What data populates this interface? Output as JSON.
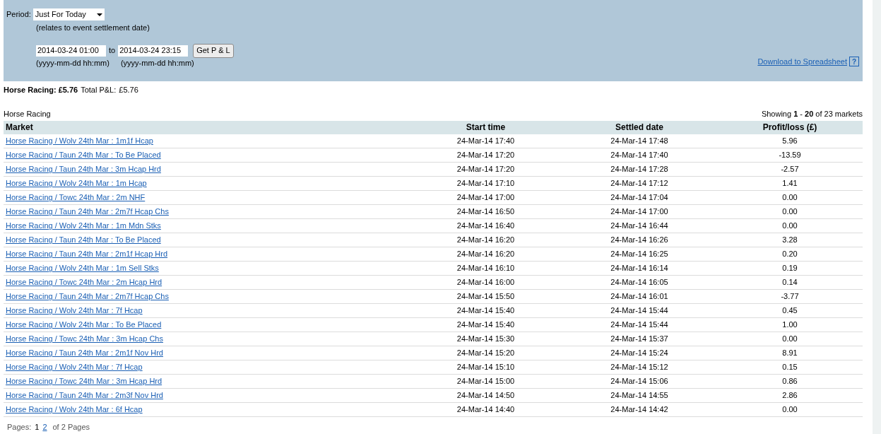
{
  "filter": {
    "period_label": "Period:",
    "period_value": "Just For Today",
    "period_note": "(relates to event settlement date)",
    "from": "2014-03-24 01:00",
    "to_label": "to",
    "to": "2014-03-24 23:15",
    "from_hint": "(yyyy-mm-dd hh:mm)",
    "to_hint": "(yyyy-mm-dd hh:mm)",
    "button": "Get P & L",
    "download_link": "Download to Spreadsheet",
    "help": "?"
  },
  "summary": {
    "sport_total": "Horse Racing: £5.76",
    "total_label": "Total P&L:",
    "total_value": "£5.76"
  },
  "table": {
    "title": "Horse Racing",
    "showing": "Showing **1** - **20** of 23 markets",
    "columns": [
      "Market",
      "Start time",
      "Settled date",
      "Profit/loss (£)"
    ],
    "rows": [
      [
        "Horse Racing / Wolv 24th Mar : 1m1f Hcap",
        "24-Mar-14 17:40",
        "24-Mar-14 17:48",
        "5.96"
      ],
      [
        "Horse Racing / Taun 24th Mar : To Be Placed",
        "24-Mar-14 17:20",
        "24-Mar-14 17:40",
        "-13.59"
      ],
      [
        "Horse Racing / Taun 24th Mar : 3m Hcap Hrd",
        "24-Mar-14 17:20",
        "24-Mar-14 17:28",
        "-2.57"
      ],
      [
        "Horse Racing / Wolv 24th Mar : 1m Hcap",
        "24-Mar-14 17:10",
        "24-Mar-14 17:12",
        "1.41"
      ],
      [
        "Horse Racing / Towc 24th Mar : 2m NHF",
        "24-Mar-14 17:00",
        "24-Mar-14 17:04",
        "0.00"
      ],
      [
        "Horse Racing / Taun 24th Mar : 2m7f Hcap Chs",
        "24-Mar-14 16:50",
        "24-Mar-14 17:00",
        "0.00"
      ],
      [
        "Horse Racing / Wolv 24th Mar : 1m Mdn Stks",
        "24-Mar-14 16:40",
        "24-Mar-14 16:44",
        "0.00"
      ],
      [
        "Horse Racing / Taun 24th Mar : To Be Placed",
        "24-Mar-14 16:20",
        "24-Mar-14 16:26",
        "3.28"
      ],
      [
        "Horse Racing / Taun 24th Mar : 2m1f Hcap Hrd",
        "24-Mar-14 16:20",
        "24-Mar-14 16:25",
        "0.20"
      ],
      [
        "Horse Racing / Wolv 24th Mar : 1m Sell Stks",
        "24-Mar-14 16:10",
        "24-Mar-14 16:14",
        "0.19"
      ],
      [
        "Horse Racing / Towc 24th Mar : 2m Hcap Hrd",
        "24-Mar-14 16:00",
        "24-Mar-14 16:05",
        "0.14"
      ],
      [
        "Horse Racing / Taun 24th Mar : 2m7f Hcap Chs",
        "24-Mar-14 15:50",
        "24-Mar-14 16:01",
        "-3.77"
      ],
      [
        "Horse Racing / Wolv 24th Mar : 7f Hcap",
        "24-Mar-14 15:40",
        "24-Mar-14 15:44",
        "0.45"
      ],
      [
        "Horse Racing / Wolv 24th Mar : To Be Placed",
        "24-Mar-14 15:40",
        "24-Mar-14 15:44",
        "1.00"
      ],
      [
        "Horse Racing / Towc 24th Mar : 3m Hcap Chs",
        "24-Mar-14 15:30",
        "24-Mar-14 15:37",
        "0.00"
      ],
      [
        "Horse Racing / Taun 24th Mar : 2m1f Nov Hrd",
        "24-Mar-14 15:20",
        "24-Mar-14 15:24",
        "8.91"
      ],
      [
        "Horse Racing / Wolv 24th Mar : 7f Hcap",
        "24-Mar-14 15:10",
        "24-Mar-14 15:12",
        "0.15"
      ],
      [
        "Horse Racing / Towc 24th Mar : 3m Hcap Hrd",
        "24-Mar-14 15:00",
        "24-Mar-14 15:06",
        "0.86"
      ],
      [
        "Horse Racing / Taun 24th Mar : 2m3f Nov Hrd",
        "24-Mar-14 14:50",
        "24-Mar-14 14:55",
        "2.86"
      ],
      [
        "Horse Racing / Wolv 24th Mar : 6f Hcap",
        "24-Mar-14 14:40",
        "24-Mar-14 14:42",
        "0.00"
      ]
    ]
  },
  "pagination": {
    "label": "Pages:",
    "pages": [
      {
        "label": "1",
        "selected": true
      },
      {
        "label": "2",
        "selected": false
      }
    ],
    "total": "of 2 Pages"
  }
}
